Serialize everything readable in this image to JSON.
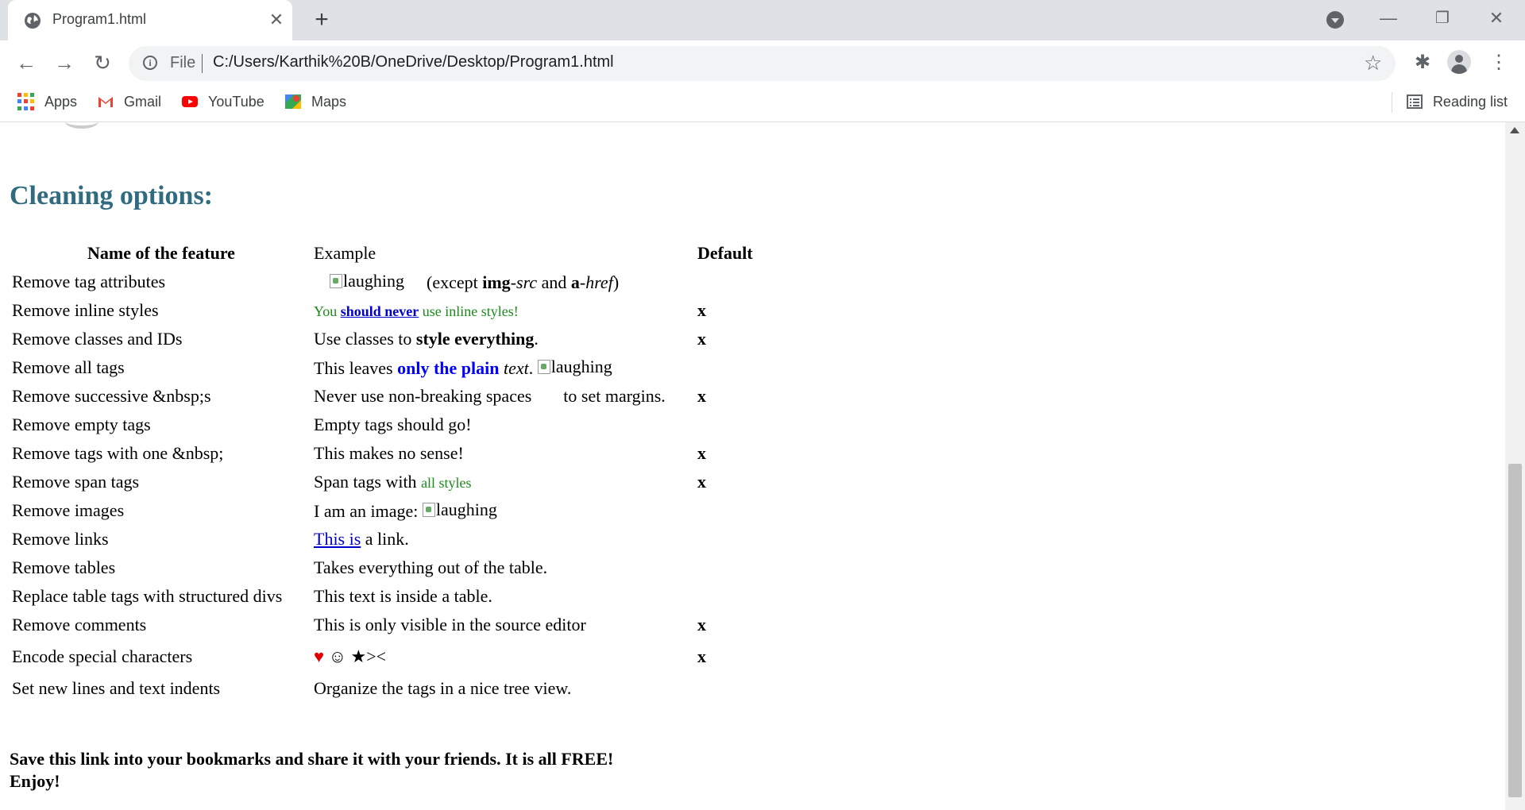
{
  "tab": {
    "title": "Program1.html",
    "close": "✕"
  },
  "newtab": "+",
  "window": {
    "minimize": "—",
    "restore": "❐",
    "close": "✕"
  },
  "toolbar": {
    "back": "←",
    "forward": "→",
    "reload": "↻",
    "info": "i",
    "scheme": "File",
    "url": "C:/Users/Karthik%20B/OneDrive/Desktop/Program1.html",
    "star": "☆",
    "extensions": "✱",
    "menu": "⋮"
  },
  "bookmarks": {
    "items": [
      {
        "label": "Apps"
      },
      {
        "label": "Gmail"
      },
      {
        "label": "YouTube"
      },
      {
        "label": "Maps"
      }
    ],
    "reading_list": "Reading list"
  },
  "page": {
    "heading": "Cleaning options:",
    "columns": {
      "name": "Name of the feature",
      "example": "Example",
      "default": "Default"
    },
    "img_alt": "laughing",
    "rows": [
      {
        "name": "Remove tag attributes",
        "default": ""
      },
      {
        "name": "Remove inline styles",
        "default": "x"
      },
      {
        "name": "Remove classes and IDs",
        "default": "x"
      },
      {
        "name": "Remove all tags",
        "default": ""
      },
      {
        "name": "Remove successive &nbsp;s",
        "default": "x"
      },
      {
        "name": "Remove empty tags",
        "default": ""
      },
      {
        "name": "Remove tags with one &nbsp;",
        "default": "x"
      },
      {
        "name": "Remove span tags",
        "default": "x"
      },
      {
        "name": "Remove images",
        "default": ""
      },
      {
        "name": "Remove links",
        "default": ""
      },
      {
        "name": "Remove tables",
        "default": ""
      },
      {
        "name": "Replace table tags with structured divs",
        "default": ""
      },
      {
        "name": "Remove comments",
        "default": "x"
      },
      {
        "name": "Encode special characters",
        "default": "x"
      },
      {
        "name": "Set new lines and text indents",
        "default": ""
      }
    ],
    "examples": {
      "r0": {
        "a": "(except ",
        "b": "img",
        "c": "-",
        "d": "src",
        "e": " and ",
        "f": "a",
        "g": "-",
        "h": "href",
        "i": ")"
      },
      "r1": {
        "a": "You ",
        "b": "should never",
        "c": " use inline styles!"
      },
      "r2": {
        "a": "Use classes to ",
        "b": "style everything",
        "c": "."
      },
      "r3": {
        "a": "This leaves ",
        "b": "only the plain",
        "c": " ",
        "d": "text",
        "e": ". "
      },
      "r4": {
        "a": "Never use non-breaking spaces",
        "b": "to set margins."
      },
      "r5": "Empty tags should go!",
      "r6": "This makes no sense!",
      "r7": {
        "a": "Span tags with ",
        "b": "all styles"
      },
      "r8": "I am an image: ",
      "r9": {
        "a": "This is",
        "b": " a link."
      },
      "r10": "Takes everything out of the table.",
      "r11": "This text is inside a table.",
      "r12": "This is only visible in the source editor",
      "r13": {
        "heart": "♥",
        "smile": "☺",
        "star": "★",
        "gtlt": "><"
      },
      "r14": "Organize the tags in a nice tree view."
    },
    "footer": {
      "line1": "Save this link into your bookmarks and share it with your friends. It is all FREE!",
      "line2": "Enjoy!"
    }
  },
  "colors": {
    "heading": "#316b80",
    "accent_blue": "#0000ff",
    "green": "#1a8a1a",
    "heart": "#e00000"
  }
}
